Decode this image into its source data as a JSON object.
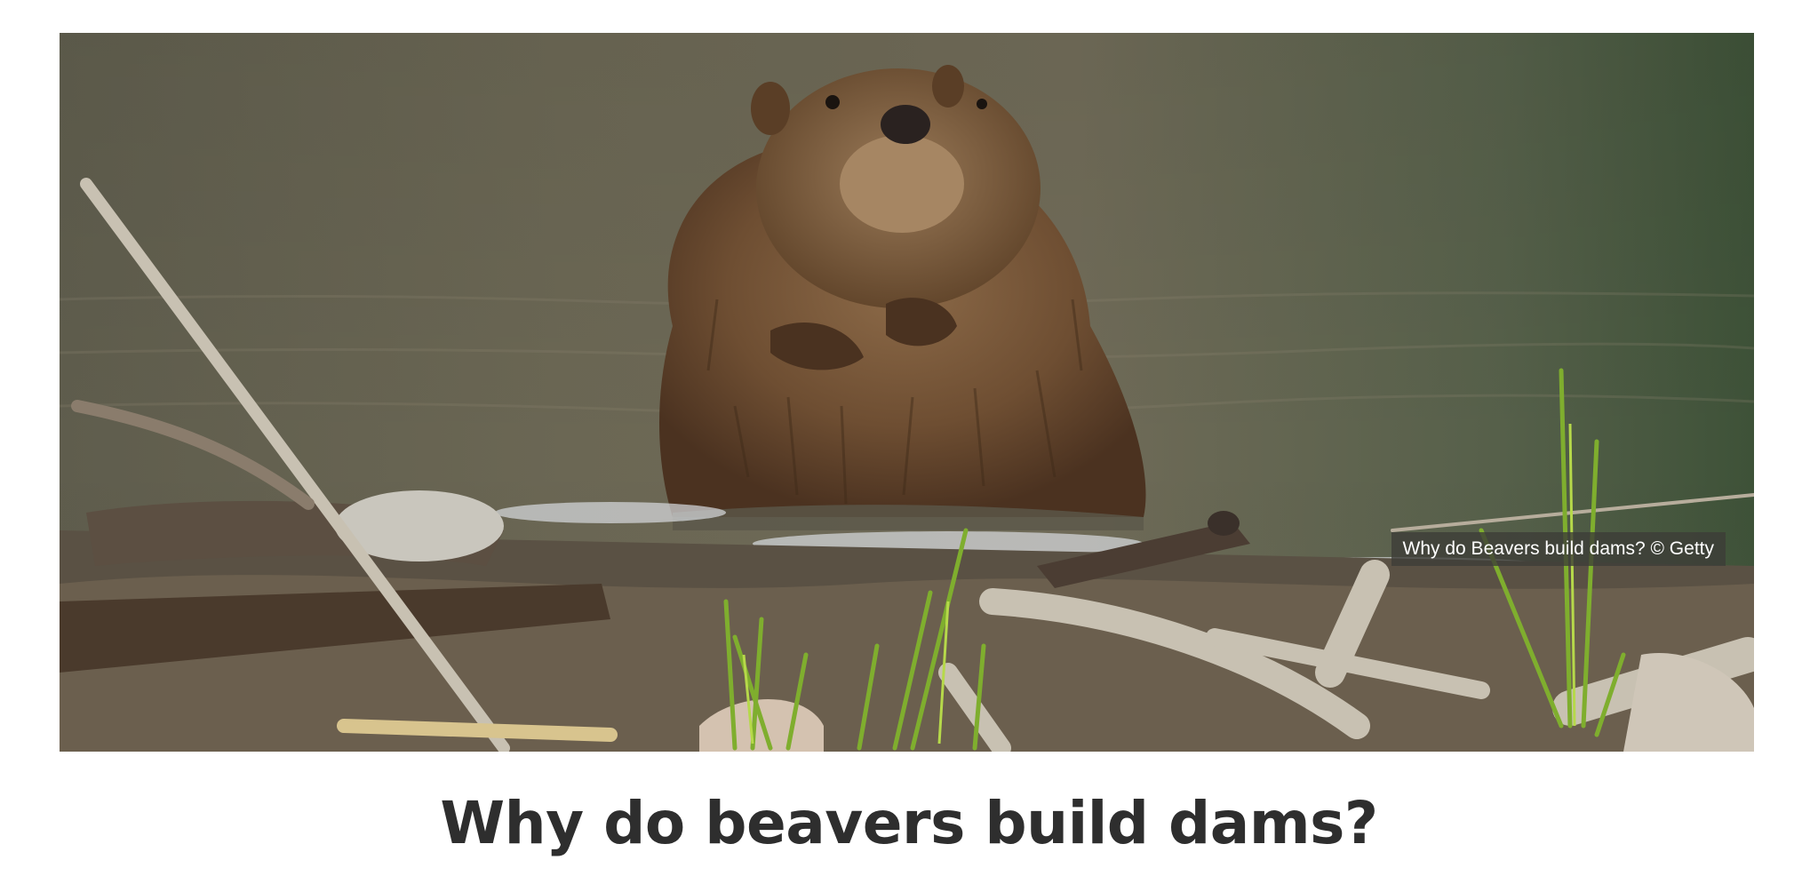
{
  "hero": {
    "image_alt": "Beaver standing in water by a dam of sticks",
    "caption": "Why do Beavers build dams? © Getty"
  },
  "article": {
    "title": "Why do beavers build dams?"
  },
  "colors": {
    "water": "#6c6a56",
    "fur": "#7a5a3c",
    "title_text": "#2e2e2e",
    "caption_bg": "#3c3c37"
  }
}
